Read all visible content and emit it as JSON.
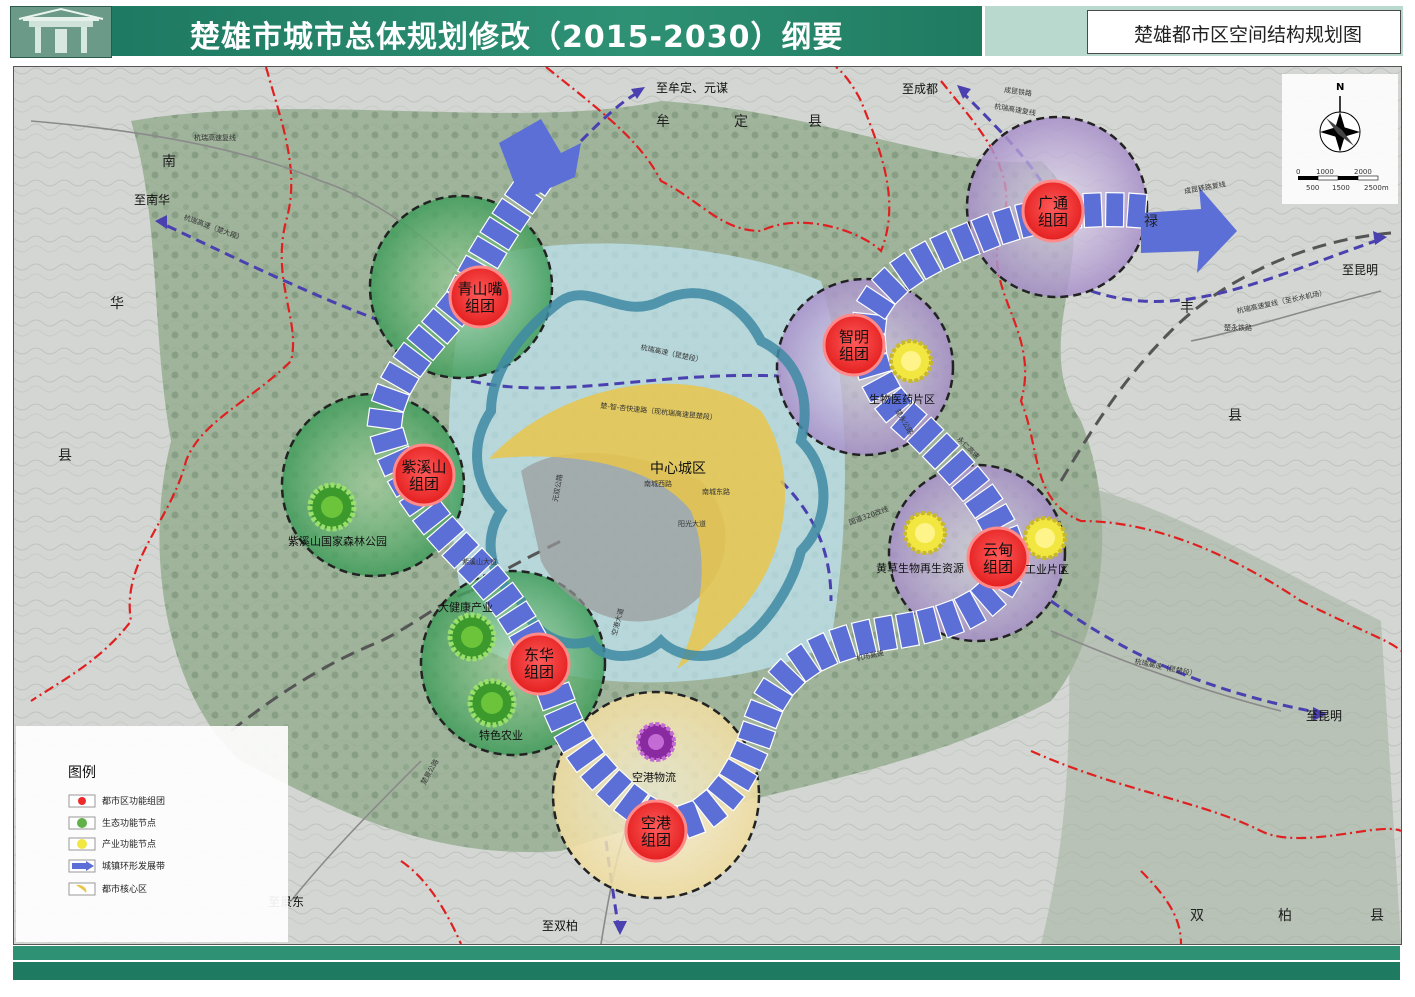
{
  "header": {
    "title": "楚雄市城市总体规划修改（2015-2030）纲要",
    "subtitle": "楚雄都市区空间结构规划图"
  },
  "clusters": [
    {
      "id": "qingshanzui",
      "label": "青山嘴\n组团"
    },
    {
      "id": "zixishan",
      "label": "紫溪山\n组团"
    },
    {
      "id": "donghua",
      "label": "东华\n组团"
    },
    {
      "id": "konggang",
      "label": "空港\n组团"
    },
    {
      "id": "zhiming",
      "label": "智明\n组团"
    },
    {
      "id": "guangtong",
      "label": "广通\n组团"
    },
    {
      "id": "yundian",
      "label": "云甸\n组团"
    }
  ],
  "labels": {
    "center": "中心城区",
    "zixishan_park": "紫溪山国家森林公园",
    "health": "大健康产业",
    "agri": "特色农业",
    "logistics": "空港物流",
    "bio_medicine": "生物医药片区",
    "bio_renew": "黄草生物再生资源",
    "industry": "工业片区"
  },
  "destinations": {
    "mouding_yuanmou": "至牟定、元谋",
    "chengdu": "至成都",
    "nanhua": "至南华",
    "kunming_top": "至昆明",
    "kunming_bottom": "至昆明",
    "jingdong": "至景东",
    "shuangbai": "至双柏"
  },
  "county_chars": {
    "nan": "南",
    "hua": "华",
    "xian_left": "县",
    "mou": "牟",
    "ding": "定",
    "xian_top": "县",
    "lu": "禄",
    "feng": "丰",
    "xian_right": "县",
    "shuang": "双",
    "bai": "柏",
    "xian_bottom": "县"
  },
  "road_labels": {
    "hangrui_fu": "杭瑞高速复线",
    "hangrui_chu": "杭瑞高速（楚大段）",
    "chengkun_fu": "成昆铁路复线",
    "chengkun": "成昆铁路",
    "hangrui_ck": "杭瑞高速复线",
    "chuyong_rail": "楚永铁路",
    "hangrui_kunming": "杭瑞高速复线（至长水机场）",
    "hangrui_chukun": "杭瑞高速（昆楚段）",
    "airport_hwy": "机场高速",
    "hangrui_chuyao": "杭瑞高速（昆楚段）",
    "chuzhi_xing": "楚-智-杏快速路（现杭瑞高速昆楚段）",
    "chujing_rail": "楚景公路",
    "zixishan_ave": "紫溪山大道",
    "nanlu": "南城西路",
    "nanlu_e": "南城东路",
    "yangguang": "阳光大道",
    "yuanshuang": "元双公路",
    "guodao": "国道320改线",
    "yongren": "永仁高速",
    "konggang_ave": "空港大道",
    "chuyong": "楚永公路"
  },
  "legend": {
    "title": "图例",
    "items": [
      {
        "label": "都市区功能组团",
        "icon": "red-circle-icon"
      },
      {
        "label": "生态功能节点",
        "icon": "green-node-icon"
      },
      {
        "label": "产业功能节点",
        "icon": "yellow-node-icon"
      },
      {
        "label": "城镇环形发展带",
        "icon": "blue-arrow-icon"
      },
      {
        "label": "都市核心区",
        "icon": "yellow-crescent-icon"
      }
    ]
  },
  "compass": {
    "north": "N",
    "scale": [
      "0",
      "1000",
      "2000",
      "500",
      "1500",
      "2500m"
    ]
  },
  "colors": {
    "title_bar": "#2e9174",
    "band": "#5b6fd6",
    "cluster_red": "#ee2a2a",
    "green_ring": "#62b04a",
    "purple_ring": "#a78fc9",
    "core_yellow": "#e9c64a",
    "boundary_red": "#e02020"
  }
}
